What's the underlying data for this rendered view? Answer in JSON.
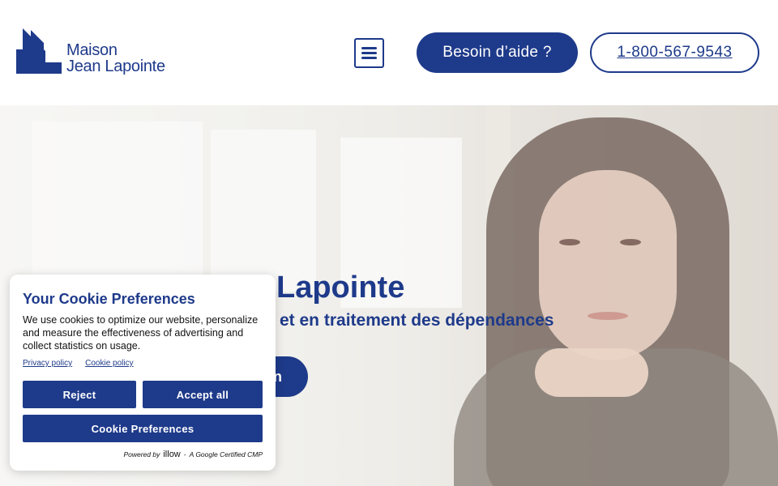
{
  "header": {
    "logo": {
      "line1": "Maison",
      "line2": "Jean Lapointe",
      "color": "#1e3a8a"
    },
    "menu_icon": "hamburger-icon",
    "help_button": "Besoin d’aide ?",
    "phone_button": "1-800-567-9543"
  },
  "hero": {
    "title": "Lapointe",
    "subtitle": "et en traitement des dépendances",
    "cta_label": "n"
  },
  "cookie": {
    "title": "Your Cookie Preferences",
    "text": "We use cookies to optimize our website, personalize and measure the effectiveness of advertising and collect statistics on usage.",
    "privacy_link": "Privacy policy",
    "cookie_link": "Cookie policy",
    "reject": "Reject",
    "accept": "Accept all",
    "preferences": "Cookie Preferences",
    "powered_by": "Powered by",
    "powered_brand": "illow",
    "powered_separator": "-",
    "certified": "A Google Certified CMP"
  },
  "colors": {
    "brand": "#1e3a8a",
    "background": "#ffffff"
  }
}
